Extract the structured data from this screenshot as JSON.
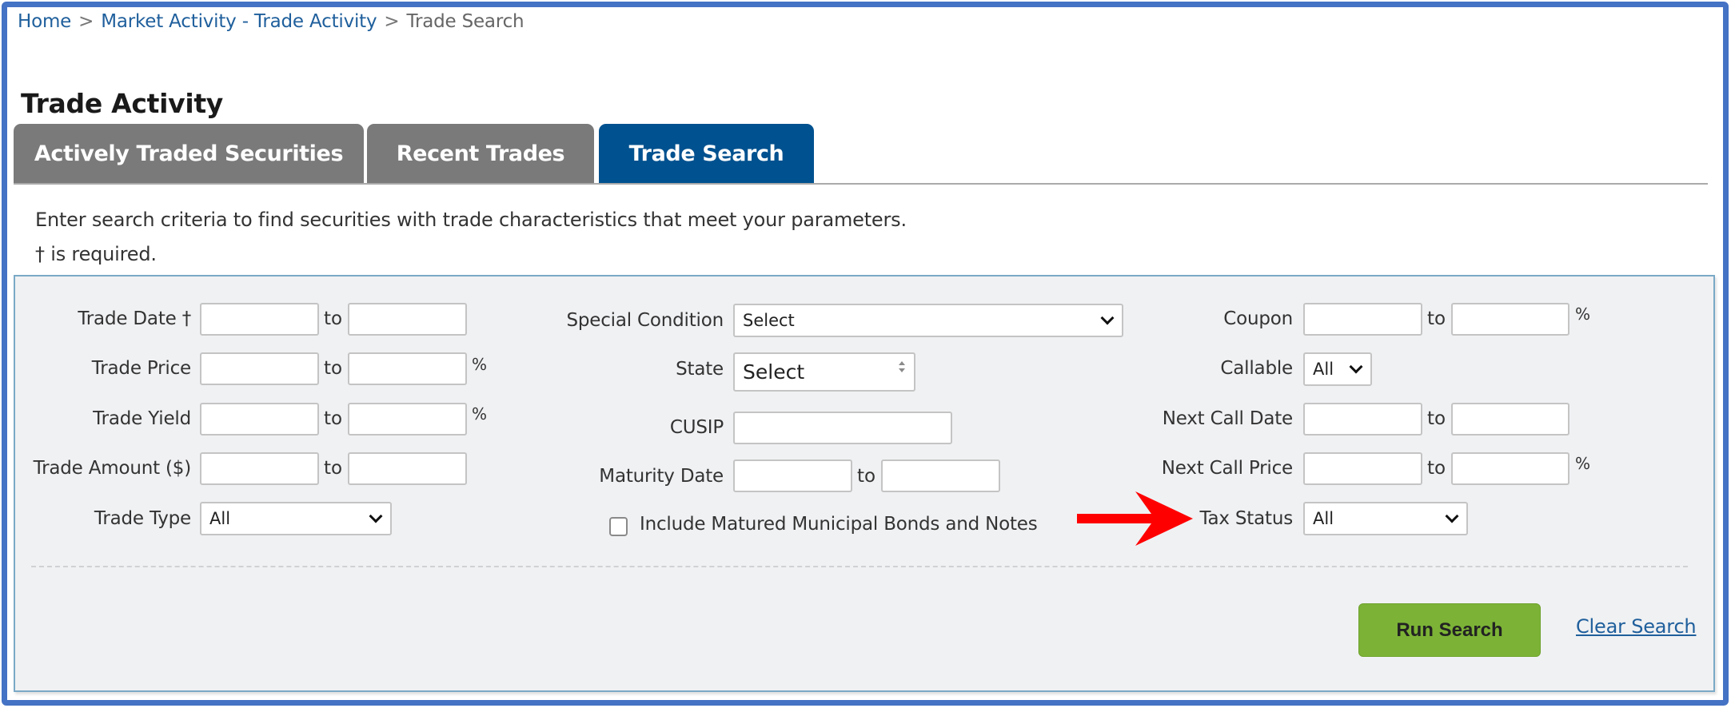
{
  "breadcrumb": {
    "items": [
      "Home",
      "Market Activity - Trade Activity"
    ],
    "separator": ">",
    "current": "Trade Search"
  },
  "page_title": "Trade Activity",
  "tabs": [
    {
      "label": "Actively Traded Securities",
      "active": false
    },
    {
      "label": "Recent Trades",
      "active": false
    },
    {
      "label": "Trade Search",
      "active": true
    }
  ],
  "intro": {
    "line1": "Enter search criteria to find securities with trade characteristics that meet your parameters.",
    "line2": "† is required."
  },
  "form": {
    "range_separator": "to",
    "percent_symbol": "%",
    "col1": {
      "trade_date": {
        "label": "Trade Date †",
        "from": "",
        "to": ""
      },
      "trade_price": {
        "label": "Trade Price",
        "from": "",
        "to": ""
      },
      "trade_yield": {
        "label": "Trade Yield",
        "from": "",
        "to": ""
      },
      "trade_amount": {
        "label": "Trade Amount ($)",
        "from": "",
        "to": ""
      },
      "trade_type": {
        "label": "Trade Type",
        "selected": "All"
      }
    },
    "col2": {
      "special_condition": {
        "label": "Special Condition",
        "selected": "Select"
      },
      "state": {
        "label": "State",
        "selected": "Select"
      },
      "cusip": {
        "label": "CUSIP",
        "value": ""
      },
      "maturity_date": {
        "label": "Maturity Date",
        "from": "",
        "to": ""
      },
      "include_matured": {
        "label": "Include Matured Municipal Bonds and Notes",
        "checked": false
      }
    },
    "col3": {
      "coupon": {
        "label": "Coupon",
        "from": "",
        "to": ""
      },
      "callable": {
        "label": "Callable",
        "selected": "All"
      },
      "next_call_date": {
        "label": "Next Call Date",
        "from": "",
        "to": ""
      },
      "next_call_price": {
        "label": "Next Call Price",
        "from": "",
        "to": ""
      },
      "tax_status": {
        "label": "Tax Status",
        "selected": "All"
      }
    }
  },
  "actions": {
    "run_search": "Run Search",
    "clear_search": "Clear Search"
  },
  "annotation": {
    "icon": "red-arrow-icon",
    "color": "#ff0000",
    "points_to": "Tax Status"
  },
  "colors": {
    "frame_border": "#4472c4",
    "tab_active": "#00518f",
    "tab_inactive": "#7a7a7a",
    "link": "#1f5f9c",
    "run_button": "#7cb336",
    "panel_bg": "#f0f1f3",
    "panel_border": "#7aa9c6"
  }
}
